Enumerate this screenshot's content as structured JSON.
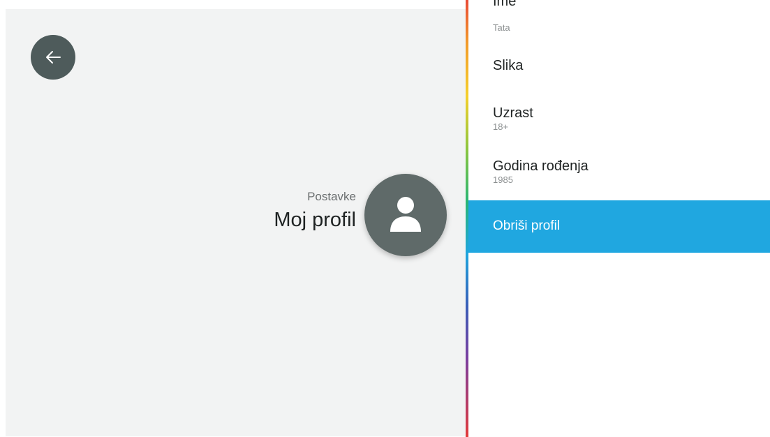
{
  "header": {
    "breadcrumb": "Postavke",
    "title": "Moj profil"
  },
  "menu": {
    "items": [
      {
        "label": "Ime",
        "value": "Tata"
      },
      {
        "label": "Slika",
        "value": ""
      },
      {
        "label": "Uzrast",
        "value": "18+"
      },
      {
        "label": "Godina rođenja",
        "value": "1985"
      },
      {
        "label": "Obriši profil",
        "value": ""
      }
    ],
    "selected_index": 4
  },
  "icons": {
    "back": "arrow-left-icon",
    "avatar": "person-icon"
  },
  "colors": {
    "left_panel_bg": "#f2f3f3",
    "icon_circle": "#4e5b5b",
    "selected_bg": "#20a7e0"
  }
}
